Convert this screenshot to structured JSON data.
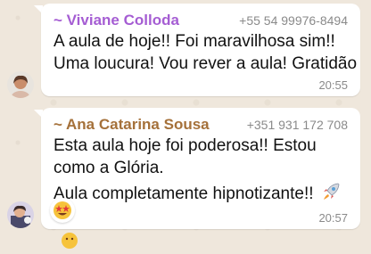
{
  "messages": [
    {
      "sender": "~ Viviane Colloda",
      "phone": "+55 54 99976-8494",
      "lines": [
        "A aula de hoje!! Foi maravilhosa sim!!",
        "Uma loucura! Vou rever a aula! Gratidão"
      ],
      "time": "20:55",
      "sender_color": "#a55dd3"
    },
    {
      "sender": "~ Ana Catarina Sousa",
      "phone": "+351 931 172 708",
      "lines": [
        "Esta aula hoje foi poderosa!! Estou",
        "como a Glória.",
        "Aula completamente hipnotizante!!"
      ],
      "time": "20:57",
      "sender_color": "#a5713a",
      "reaction_icon": "starry-eyed-emoji",
      "inline_icon": "rocket-emoji"
    }
  ],
  "partial_next": {
    "icon": "smiling-emoji"
  }
}
